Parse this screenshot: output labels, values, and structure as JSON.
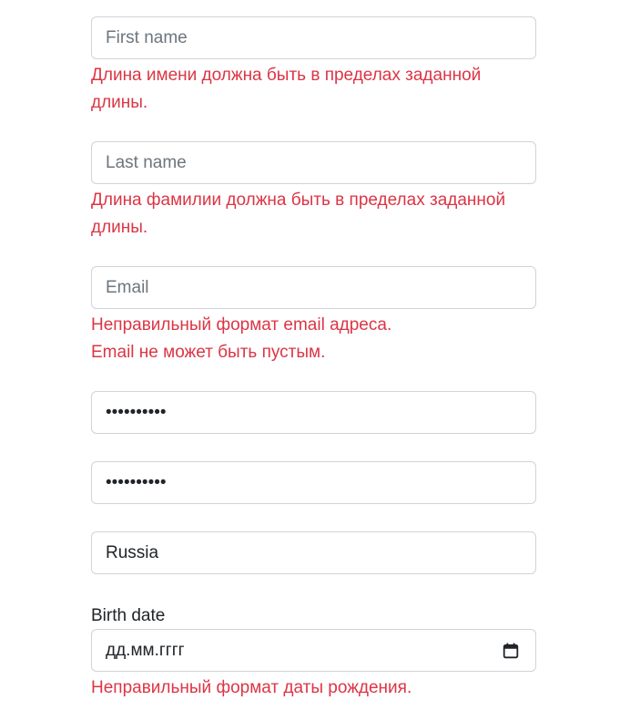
{
  "form": {
    "first_name": {
      "placeholder": "First name",
      "error": "Длина имени должна быть в пределах заданной длины."
    },
    "last_name": {
      "placeholder": "Last name",
      "error": "Длина фамилии должна быть в пределах заданной длины."
    },
    "email": {
      "placeholder": "Email",
      "errors": [
        "Неправильный формат email адреса.",
        "Email не может быть пустым."
      ]
    },
    "password": {
      "masked_value": "••••••••••"
    },
    "confirm_password": {
      "masked_value": "••••••••••"
    },
    "country": {
      "value": "Russia"
    },
    "birth_date": {
      "label": "Birth date",
      "placeholder": "дд.мм.гггг",
      "icon": "calendar-icon",
      "error": "Неправильный формат даты рождения."
    }
  },
  "colors": {
    "error": "#dc3545",
    "border": "#ced4da",
    "placeholder": "#6c757d",
    "text": "#212529"
  }
}
